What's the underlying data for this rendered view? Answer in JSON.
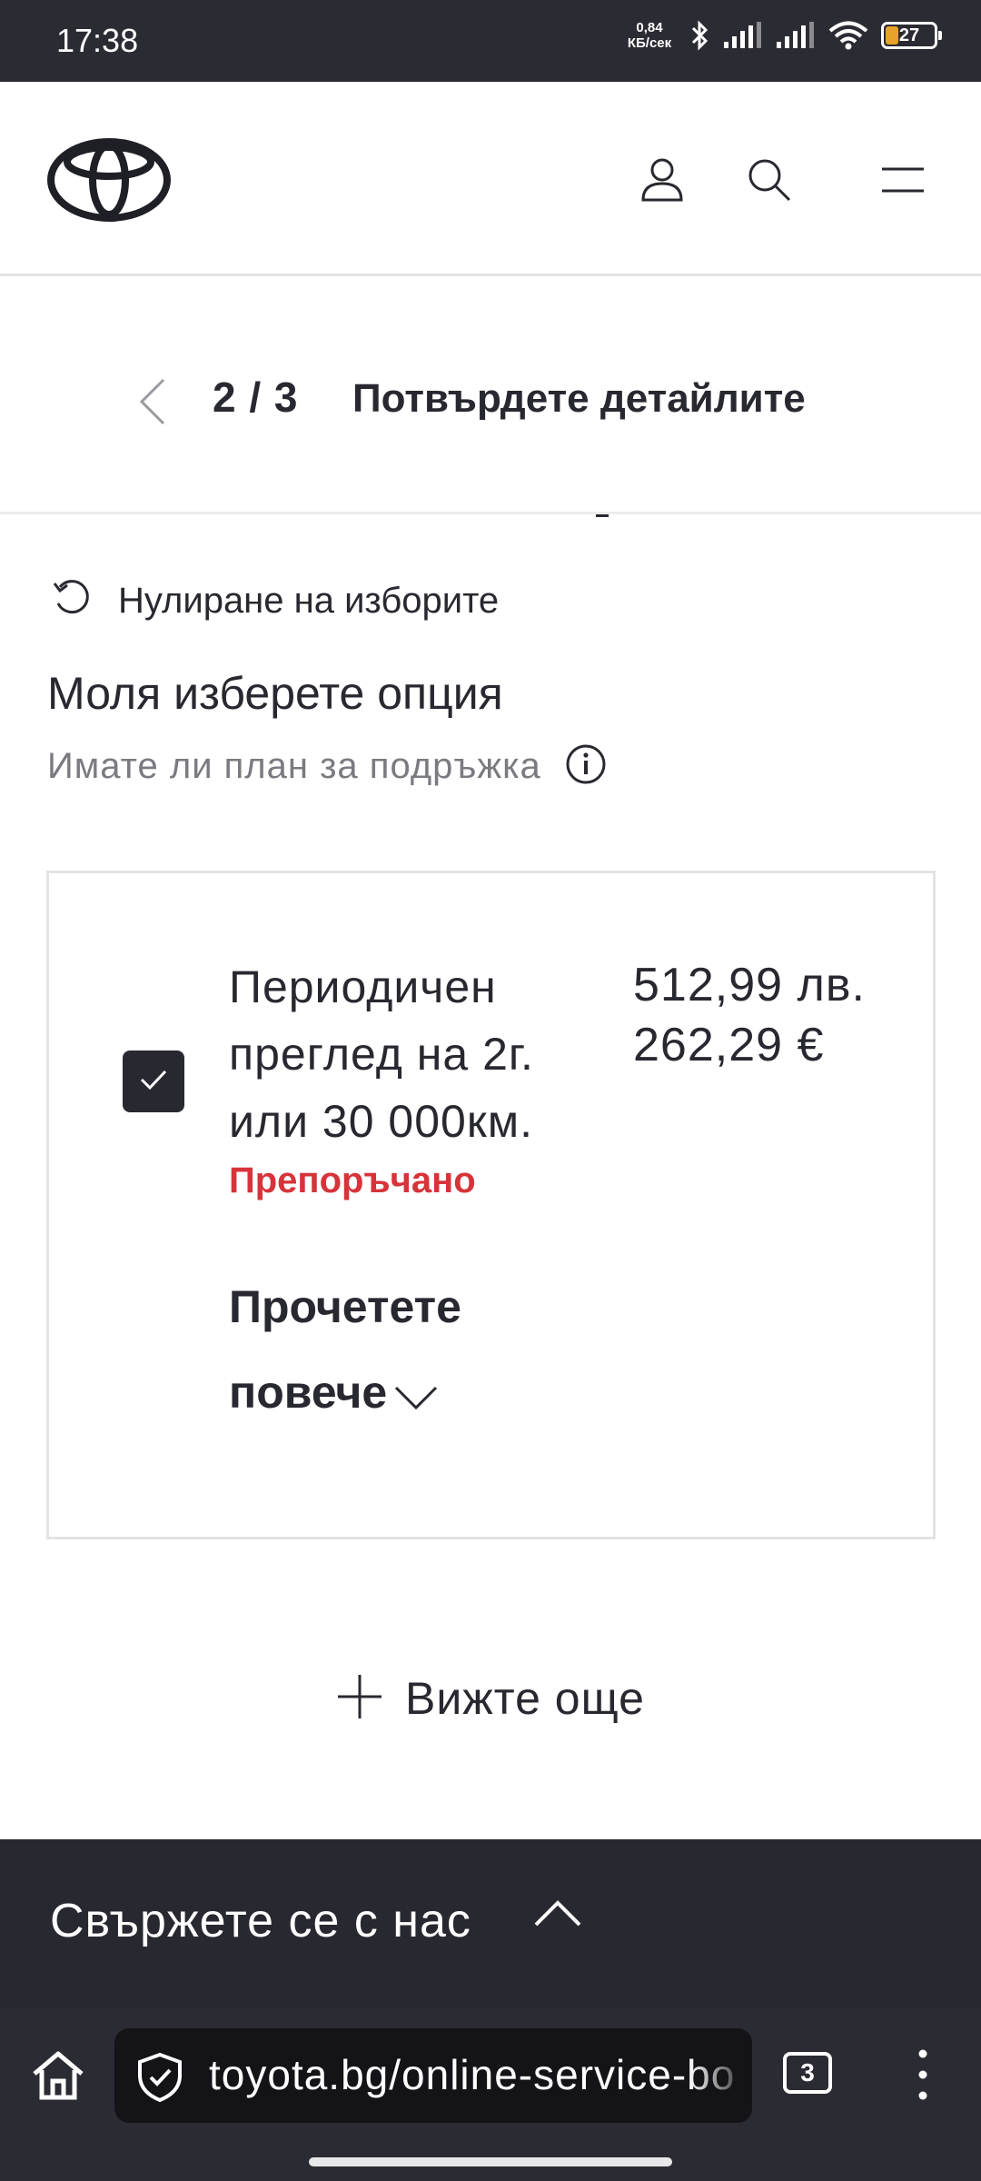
{
  "status_bar": {
    "time": "17:38",
    "net_speed_value": "0,84",
    "net_speed_unit": "КБ/сек",
    "battery": "27",
    "icons": [
      "bluetooth-icon",
      "signal-icon",
      "signal-icon",
      "wifi-icon",
      "battery-icon"
    ]
  },
  "header": {
    "brand": "toyota-logo",
    "icons": [
      "account-icon",
      "search-icon",
      "menu-icon"
    ]
  },
  "stepper": {
    "count": "2 / 3",
    "title": "Потвърдете детайлите"
  },
  "content": {
    "reset_label": "Нулиране на изборите",
    "heading": "Моля изберете опция",
    "subtitle": "Имате ли план за подръжка",
    "option": {
      "checked": true,
      "name": "Периодичен преглед на 2г. или 30 000км.",
      "badge": "Препоръчано",
      "price_bgn": "512,99 лв.",
      "price_eur": "262,29 €",
      "read_more": "Прочетете повече"
    },
    "see_more": "Вижте още"
  },
  "footer": {
    "contact_label": "Свържете се с нас"
  },
  "browser": {
    "url": "toyota.bg/online-service-bo",
    "tab_count": "3"
  },
  "colors": {
    "accent_red": "#d7333a",
    "dark": "#282830",
    "muted": "#7a7a80"
  }
}
